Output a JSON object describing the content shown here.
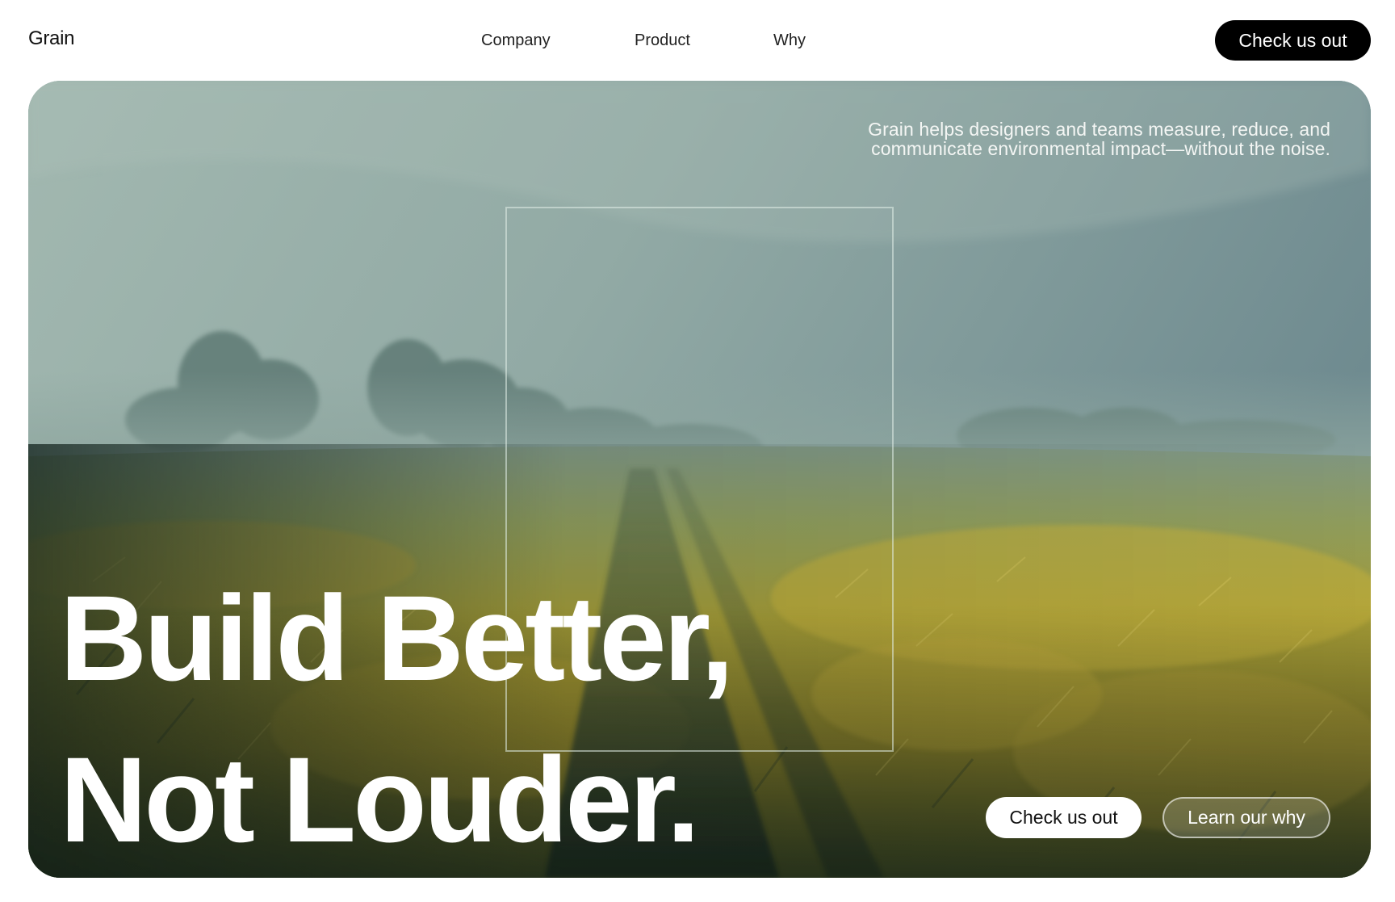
{
  "brand": {
    "logo_text": "Grain"
  },
  "nav": {
    "links": [
      {
        "label": "Company"
      },
      {
        "label": "Product"
      },
      {
        "label": "Why"
      }
    ],
    "cta_label": "Check us out"
  },
  "hero": {
    "tagline_line1": "Grain helps designers and teams measure, reduce, and",
    "tagline_line2": "communicate environmental impact—without the noise.",
    "headline_line1": "Build Better,",
    "headline_line2": "Not Louder.",
    "primary_cta_label": "Check us out",
    "secondary_cta_label": "Learn our why",
    "image_description": "painted-misty-wheat-field"
  },
  "colors": {
    "accent": "#000000",
    "button_light": "#ffffff",
    "text_on_image": "#ffffff",
    "sky": "#8fa8a3",
    "field": "#b7a23a"
  }
}
